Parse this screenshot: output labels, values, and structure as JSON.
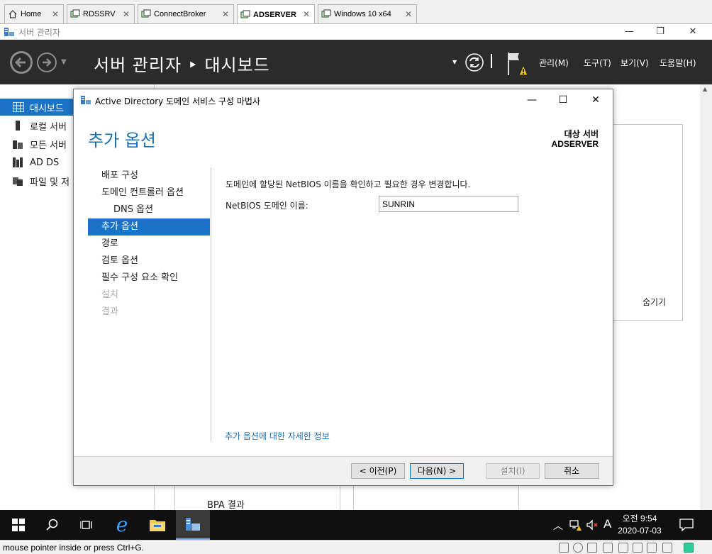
{
  "vm_tabs": [
    {
      "label": "Home",
      "icon": "home-icon"
    },
    {
      "label": "RDSSRV",
      "icon": "vm-icon"
    },
    {
      "label": "ConnectBroker",
      "icon": "vm-icon"
    },
    {
      "label": "ADSERVER",
      "icon": "vm-icon",
      "active": true
    },
    {
      "label": "Windows 10 x64",
      "icon": "vm-icon"
    }
  ],
  "server_manager": {
    "window_title": "서버 관리자",
    "header_title": "서버 관리자 ‣ 대시보드",
    "menu": [
      "관리(M)",
      "도구(T)",
      "보기(V)",
      "도움말(H)"
    ],
    "leftnav": [
      {
        "label": "대시보드",
        "icon": "dashboard-icon",
        "active": true
      },
      {
        "label": "로컬 서버",
        "icon": "local-server-icon"
      },
      {
        "label": "모든 서버",
        "icon": "all-servers-icon"
      },
      {
        "label": "AD DS",
        "icon": "adds-icon"
      },
      {
        "label": "파일 및 저",
        "icon": "file-storage-icon"
      }
    ],
    "background": {
      "hide_label": "숨기기",
      "bpa_label": "BPA 결과"
    }
  },
  "wizard": {
    "title": "Active Directory 도메인 서비스 구성 마법사",
    "heading": "추가 옵션",
    "target_label": "대상 서버",
    "target_value": "ADSERVER",
    "steps": [
      {
        "label": "배포 구성",
        "state": "normal"
      },
      {
        "label": "도메인 컨트롤러 옵션",
        "state": "normal"
      },
      {
        "label": "DNS 옵션",
        "state": "sub"
      },
      {
        "label": "추가 옵션",
        "state": "active"
      },
      {
        "label": "경로",
        "state": "normal"
      },
      {
        "label": "검토 옵션",
        "state": "normal"
      },
      {
        "label": "필수 구성 요소 확인",
        "state": "normal"
      },
      {
        "label": "설치",
        "state": "disabled"
      },
      {
        "label": "결과",
        "state": "disabled"
      }
    ],
    "description": "도메인에 할당된 NetBIOS 이름을 확인하고 필요한 경우 변경합니다.",
    "netbios_label": "NetBIOS 도메인 이름:",
    "netbios_value": "SUNRIN",
    "more_info_link": "추가 옵션에 대한 자세한 정보",
    "buttons": {
      "prev": "< 이전(P)",
      "next": "다음(N) >",
      "install": "설치(I)",
      "cancel": "취소"
    }
  },
  "taskbar": {
    "time": "오전 9:54",
    "date": "2020-07-03",
    "ime": "A"
  },
  "vm_status": {
    "text": "mouse pointer inside or press Ctrl+G."
  },
  "colors": {
    "accent": "#1a73c6",
    "link": "#1a6fb5",
    "header_bg": "#2b2b2b",
    "taskbar_bg": "#101010"
  }
}
